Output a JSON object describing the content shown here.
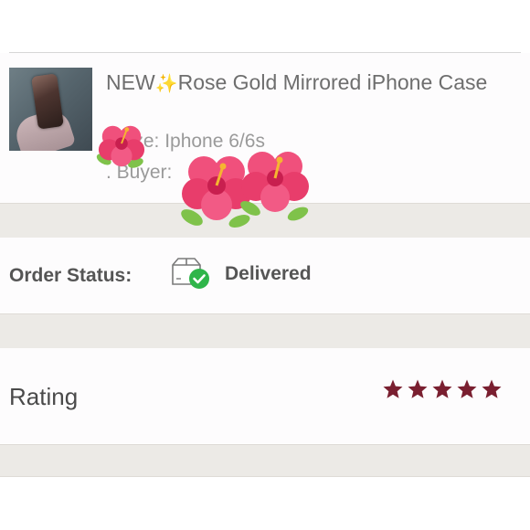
{
  "item": {
    "title_prefix": "NEW",
    "title_rest": "Rose Gold Mirrored iPhone Case",
    "size_line": ". Size: Iphone 6/6s",
    "buyer_line": ". Buyer:",
    "thumbnail_icon": "phone-case-photo-icon",
    "sparkle_icon": "sparkles-icon"
  },
  "order_status": {
    "label": "Order Status:",
    "value": "Delivered",
    "icon": "package-delivered-icon"
  },
  "rating": {
    "label": "Rating",
    "stars": 5,
    "max_stars": 5,
    "star_color": "#7a1f30"
  },
  "decorations": {
    "flower_icon": "hibiscus-icon",
    "flower_color": "#f04a78"
  },
  "colors": {
    "band": "#eceae6",
    "card": "#fdfcfd",
    "check_green": "#2fb54a"
  }
}
